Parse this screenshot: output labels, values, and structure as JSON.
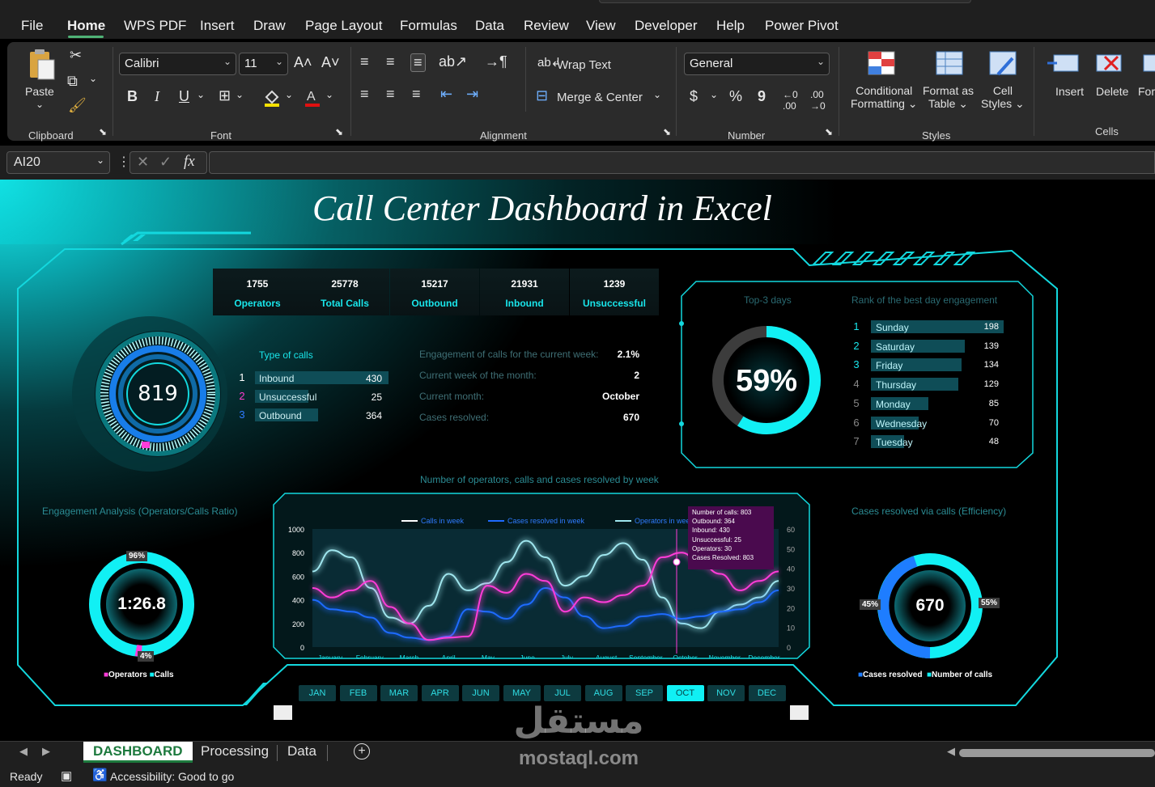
{
  "menu": {
    "tabs": [
      "File",
      "Home",
      "WPS PDF",
      "Insert",
      "Draw",
      "Page Layout",
      "Formulas",
      "Data",
      "Review",
      "View",
      "Developer",
      "Help",
      "Power Pivot"
    ]
  },
  "ribbon": {
    "clipboard": {
      "paste": "Paste",
      "group": "Clipboard"
    },
    "font": {
      "name": "Calibri",
      "size": "11",
      "group": "Font",
      "bold": "B",
      "italic": "I",
      "underline": "U"
    },
    "alignment": {
      "wrap": "Wrap Text",
      "merge": "Merge & Center",
      "group": "Alignment"
    },
    "number": {
      "format": "General",
      "group": "Number",
      "currency": "$",
      "percent": "%",
      "comma": "9"
    },
    "styles": {
      "cond1": "Conditional",
      "cond2": "Formatting",
      "fmt1": "Format as",
      "fmt2": "Table",
      "cell1": "Cell",
      "cell2": "Styles",
      "group": "Styles"
    },
    "cells": {
      "insert": "Insert",
      "delete": "Delete",
      "format": "Form",
      "group": "Cells"
    }
  },
  "formula": {
    "namebox": "AI20",
    "fx": "fx",
    "value": ""
  },
  "dashboard": {
    "title": "Call Center Dashboard in Excel",
    "kpis": [
      {
        "value": "1755",
        "label": "Operators"
      },
      {
        "value": "25778",
        "label": "Total Calls"
      },
      {
        "value": "15217",
        "label": "Outbound"
      },
      {
        "value": "21931",
        "label": "Inbound"
      },
      {
        "value": "1239",
        "label": "Unsuccessful"
      }
    ],
    "gauge": {
      "value": "819"
    },
    "type_of_calls": {
      "title": "Type of calls",
      "rows": [
        {
          "n": "1",
          "label": "Inbound",
          "value": "430",
          "color": "#ffffff",
          "frac": 1.0
        },
        {
          "n": "2",
          "label": "Unsuccessful",
          "value": "25",
          "color": "#ff3cd0",
          "frac": 0.4
        },
        {
          "n": "3",
          "label": "Outbound",
          "value": "364",
          "color": "#2f7bff",
          "frac": 0.47
        }
      ]
    },
    "engagement": {
      "rows": [
        {
          "label": "Engagement of calls for the current week:",
          "value": "2.1%"
        },
        {
          "label": "Current week of the month:",
          "value": "2"
        },
        {
          "label": "Current month:",
          "value": "October"
        },
        {
          "label": "Cases resolved:",
          "value": "670"
        }
      ]
    },
    "top3": {
      "title": "Top-3 days",
      "value": "59%",
      "fraction": 0.59
    },
    "rank": {
      "title": "Rank of the best day engagement",
      "rows": [
        {
          "n": "1",
          "day": "Sunday",
          "v": "198",
          "frac": 1.0
        },
        {
          "n": "2",
          "day": "Saturday",
          "v": "139",
          "frac": 0.71
        },
        {
          "n": "3",
          "day": "Friday",
          "v": "134",
          "frac": 0.68
        },
        {
          "n": "4",
          "day": "Thursday",
          "v": "129",
          "frac": 0.66
        },
        {
          "n": "5",
          "day": "Monday",
          "v": "85",
          "frac": 0.43
        },
        {
          "n": "6",
          "day": "Wednesday",
          "v": "70",
          "frac": 0.36
        },
        {
          "n": "7",
          "day": "Tuesday",
          "v": "48",
          "frac": 0.25
        }
      ]
    },
    "engagement_analysis": {
      "title": "Engagement Analysis (Operators/Calls Ratio)",
      "value": "1:26.8",
      "pct_calls": "96%",
      "pct_ops": "4%",
      "legend_ops": "Operators",
      "legend_calls": "Calls"
    },
    "efficiency": {
      "title": "Cases resolved via calls (Efficiency)",
      "value": "670",
      "pct_resolved": "45%",
      "pct_calls": "55%",
      "legend_resolved": "Cases resolved",
      "legend_calls": "Number of calls"
    },
    "months": [
      "JAN",
      "FEB",
      "MAR",
      "APR",
      "JUN",
      "MAY",
      "JUL",
      "AUG",
      "SEP",
      "OCT",
      "NOV",
      "DEC"
    ],
    "selected_month": "OCT",
    "tooltip": [
      "Number of calls: 803",
      "Outbound: 364",
      "Inbound: 430",
      "Unsuccessful: 25",
      "Operators: 30",
      "Cases Resolved: 803"
    ]
  },
  "chart_data": {
    "type": "line",
    "title": "Number of operators, calls and cases resolved by week",
    "categories": [
      "January",
      "February",
      "March",
      "April",
      "May",
      "June",
      "July",
      "August",
      "September",
      "October",
      "November",
      "December"
    ],
    "yleft": {
      "ticks": [
        "1000",
        "800",
        "600",
        "400",
        "200",
        "0"
      ],
      "ylim": [
        0,
        1000
      ]
    },
    "yright": {
      "ticks": [
        "60",
        "50",
        "40",
        "30",
        "20",
        "10",
        "0"
      ],
      "ylim": [
        0,
        60
      ]
    },
    "series": [
      {
        "name": "Calls in week",
        "color": "#ff3cd8",
        "axis": "left",
        "values": [
          500,
          420,
          480,
          560,
          340,
          200,
          60,
          80,
          90,
          520,
          460,
          620,
          560,
          300,
          420,
          380,
          440,
          520,
          760,
          800,
          700,
          620,
          480,
          560,
          640
        ]
      },
      {
        "name": "Cases resolved in week",
        "color": "#1e6bff",
        "axis": "left",
        "values": [
          400,
          320,
          300,
          250,
          120,
          80,
          60,
          90,
          320,
          300,
          240,
          360,
          500,
          420,
          260,
          160,
          180,
          260,
          280,
          240,
          260,
          300,
          320,
          380,
          480
        ]
      },
      {
        "name": "Operators in week",
        "color": "#9fe6ee",
        "axis": "left",
        "values": [
          640,
          820,
          760,
          500,
          250,
          200,
          350,
          620,
          480,
          540,
          720,
          900,
          760,
          520,
          600,
          780,
          880,
          740,
          420,
          200,
          160,
          300,
          360,
          420,
          560
        ]
      }
    ]
  },
  "sheets": {
    "tabs": [
      "DASHBOARD",
      "Processing",
      "Data"
    ],
    "active": "DASHBOARD"
  },
  "status": {
    "ready": "Ready",
    "access": "Accessibility: Good to go"
  },
  "watermark": {
    "ar": "مستقل",
    "en": "mostaql.com"
  }
}
